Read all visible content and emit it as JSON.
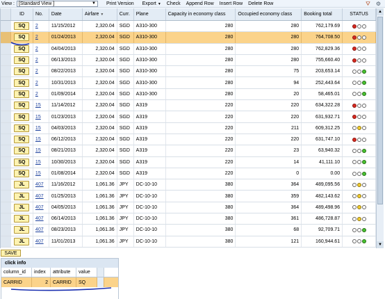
{
  "toolbar": {
    "view_label": "View :",
    "view_value": "[Standard View ]",
    "items": [
      "Print Version",
      "Export",
      "Check",
      "Append Row",
      "Insert Row",
      "Delete Row"
    ]
  },
  "columns": [
    "ID",
    "No.",
    "Date",
    "Airfare",
    "Curr.",
    "Plane",
    "Capacity in economy class",
    "Occupied economy class",
    "Booking total",
    "STATUS"
  ],
  "rows": [
    {
      "id": "SQ",
      "no": "2",
      "date": "11/15/2012",
      "airfare": "2,320.04",
      "curr": "SGD",
      "plane": "A310-300",
      "cap": "280",
      "occ": "280",
      "total": "762,179.69",
      "status": "red"
    },
    {
      "id": "SQ",
      "no": "2",
      "date": "01/24/2013",
      "airfare": "2,320.04",
      "curr": "SGD",
      "plane": "A310-300",
      "cap": "280",
      "occ": "280",
      "total": "764,708.50",
      "status": "red"
    },
    {
      "id": "SQ",
      "no": "2",
      "date": "04/04/2013",
      "airfare": "2,320.04",
      "curr": "SGD",
      "plane": "A310-300",
      "cap": "280",
      "occ": "280",
      "total": "762,829.36",
      "status": "red"
    },
    {
      "id": "SQ",
      "no": "2",
      "date": "06/13/2013",
      "airfare": "2,320.04",
      "curr": "SGD",
      "plane": "A310-300",
      "cap": "280",
      "occ": "280",
      "total": "755,660.40",
      "status": "red"
    },
    {
      "id": "SQ",
      "no": "2",
      "date": "08/22/2013",
      "airfare": "2,320.04",
      "curr": "SGD",
      "plane": "A310-300",
      "cap": "280",
      "occ": "75",
      "total": "203,653.14",
      "status": "green"
    },
    {
      "id": "SQ",
      "no": "2",
      "date": "10/31/2013",
      "airfare": "2,320.04",
      "curr": "SGD",
      "plane": "A310-300",
      "cap": "280",
      "occ": "94",
      "total": "252,443.64",
      "status": "green"
    },
    {
      "id": "SQ",
      "no": "2",
      "date": "01/09/2014",
      "airfare": "2,320.04",
      "curr": "SGD",
      "plane": "A310-300",
      "cap": "280",
      "occ": "20",
      "total": "58,465.01",
      "status": "green"
    },
    {
      "id": "SQ",
      "no": "15",
      "date": "11/14/2012",
      "airfare": "2,320.04",
      "curr": "SGD",
      "plane": "A319",
      "cap": "220",
      "occ": "220",
      "total": "634,322.28",
      "status": "red"
    },
    {
      "id": "SQ",
      "no": "15",
      "date": "01/23/2013",
      "airfare": "2,320.04",
      "curr": "SGD",
      "plane": "A319",
      "cap": "220",
      "occ": "220",
      "total": "631,932.71",
      "status": "red"
    },
    {
      "id": "SQ",
      "no": "15",
      "date": "04/03/2013",
      "airfare": "2,320.04",
      "curr": "SGD",
      "plane": "A319",
      "cap": "220",
      "occ": "211",
      "total": "609,312.25",
      "status": "yellow"
    },
    {
      "id": "SQ",
      "no": "15",
      "date": "06/12/2013",
      "airfare": "2,320.04",
      "curr": "SGD",
      "plane": "A319",
      "cap": "220",
      "occ": "220",
      "total": "631,747.10",
      "status": "red"
    },
    {
      "id": "SQ",
      "no": "15",
      "date": "08/21/2013",
      "airfare": "2,320.04",
      "curr": "SGD",
      "plane": "A319",
      "cap": "220",
      "occ": "23",
      "total": "63,940.32",
      "status": "green"
    },
    {
      "id": "SQ",
      "no": "15",
      "date": "10/30/2013",
      "airfare": "2,320.04",
      "curr": "SGD",
      "plane": "A319",
      "cap": "220",
      "occ": "14",
      "total": "41,111.10",
      "status": "green"
    },
    {
      "id": "SQ",
      "no": "15",
      "date": "01/08/2014",
      "airfare": "2,320.04",
      "curr": "SGD",
      "plane": "A319",
      "cap": "220",
      "occ": "0",
      "total": "0.00",
      "status": "green"
    },
    {
      "id": "JL",
      "no": "407",
      "date": "11/16/2012",
      "airfare": "1,061.36",
      "curr": "JPY",
      "plane": "DC-10-10",
      "cap": "380",
      "occ": "364",
      "total": "489,095.56",
      "status": "yellow"
    },
    {
      "id": "JL",
      "no": "407",
      "date": "01/25/2013",
      "airfare": "1,061.36",
      "curr": "JPY",
      "plane": "DC-10-10",
      "cap": "380",
      "occ": "359",
      "total": "482,143.62",
      "status": "yellow"
    },
    {
      "id": "JL",
      "no": "407",
      "date": "04/05/2013",
      "airfare": "1,061.36",
      "curr": "JPY",
      "plane": "DC-10-10",
      "cap": "380",
      "occ": "364",
      "total": "489,498.96",
      "status": "yellow"
    },
    {
      "id": "JL",
      "no": "407",
      "date": "06/14/2013",
      "airfare": "1,061.36",
      "curr": "JPY",
      "plane": "DC-10-10",
      "cap": "380",
      "occ": "361",
      "total": "486,728.87",
      "status": "yellow"
    },
    {
      "id": "JL",
      "no": "407",
      "date": "08/23/2013",
      "airfare": "1,061.36",
      "curr": "JPY",
      "plane": "DC-10-10",
      "cap": "380",
      "occ": "68",
      "total": "92,709.71",
      "status": "green"
    },
    {
      "id": "JL",
      "no": "407",
      "date": "11/01/2013",
      "airfare": "1,061.36",
      "curr": "JPY",
      "plane": "DC-10-10",
      "cap": "380",
      "occ": "121",
      "total": "160,944.61",
      "status": "green"
    }
  ],
  "selected_row": 1,
  "save_label": "SAVE",
  "click_info": {
    "title": "click info",
    "columns": [
      "column_id",
      "index",
      "attribute",
      "value"
    ],
    "row": {
      "column_id": "CARRID",
      "index": "2",
      "attribute": "CARRID",
      "value": "SQ"
    }
  },
  "colors": {
    "selection": "#fbd38a",
    "link": "#1a3f9c",
    "button": "#fff3b0",
    "annotation": "#1a2fb0"
  },
  "icons": [
    "filter-icon",
    "settings-icon",
    "dropdown-arrow-icon",
    "sort-desc-icon",
    "scroll-up-icon",
    "scroll-down-icon",
    "status-light-icon"
  ]
}
